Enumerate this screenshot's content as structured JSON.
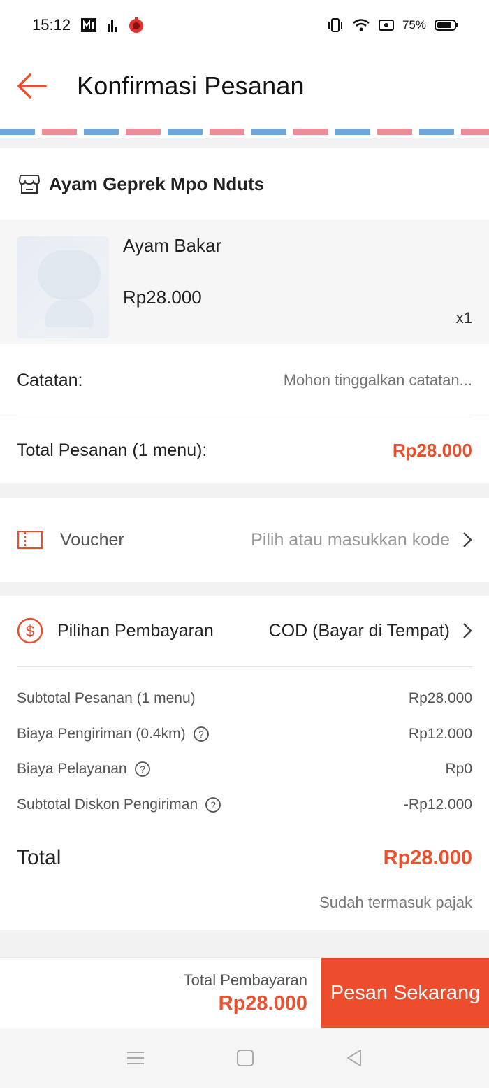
{
  "status_bar": {
    "time": "15:12",
    "battery": "75%"
  },
  "header": {
    "title": "Konfirmasi Pesanan"
  },
  "store": {
    "name": "Ayam Geprek Mpo Nduts"
  },
  "item": {
    "name": "Ayam Bakar",
    "price": "Rp28.000",
    "qty": "x1"
  },
  "notes": {
    "label": "Catatan:",
    "placeholder": "Mohon tinggalkan catatan..."
  },
  "order_total": {
    "label": "Total Pesanan (1 menu):",
    "value": "Rp28.000"
  },
  "voucher": {
    "label": "Voucher",
    "hint": "Pilih atau masukkan kode"
  },
  "payment": {
    "label": "Pilihan Pembayaran",
    "value": "COD (Bayar di Tempat)"
  },
  "summary": [
    {
      "label": "Subtotal Pesanan (1 menu)",
      "value": "Rp28.000"
    },
    {
      "label": "Biaya Pengiriman (0.4km)",
      "value": "Rp12.000"
    },
    {
      "label": "Biaya Pelayanan",
      "value": "Rp0"
    },
    {
      "label": "Subtotal Diskon Pengiriman",
      "value": "-Rp12.000"
    }
  ],
  "grand_total": {
    "label": "Total",
    "value": "Rp28.000",
    "note": "Sudah termasuk pajak"
  },
  "footer": {
    "pay_label": "Total Pembayaran",
    "pay_value": "Rp28.000",
    "order_button": "Pesan Sekarang"
  },
  "colors": {
    "accent": "#ee4d2d",
    "price": "#e8502e"
  },
  "icons": [
    "back-arrow-icon",
    "store-icon",
    "voucher-icon",
    "dollar-circle-icon",
    "chevron-right-icon",
    "help-circle-icon"
  ]
}
